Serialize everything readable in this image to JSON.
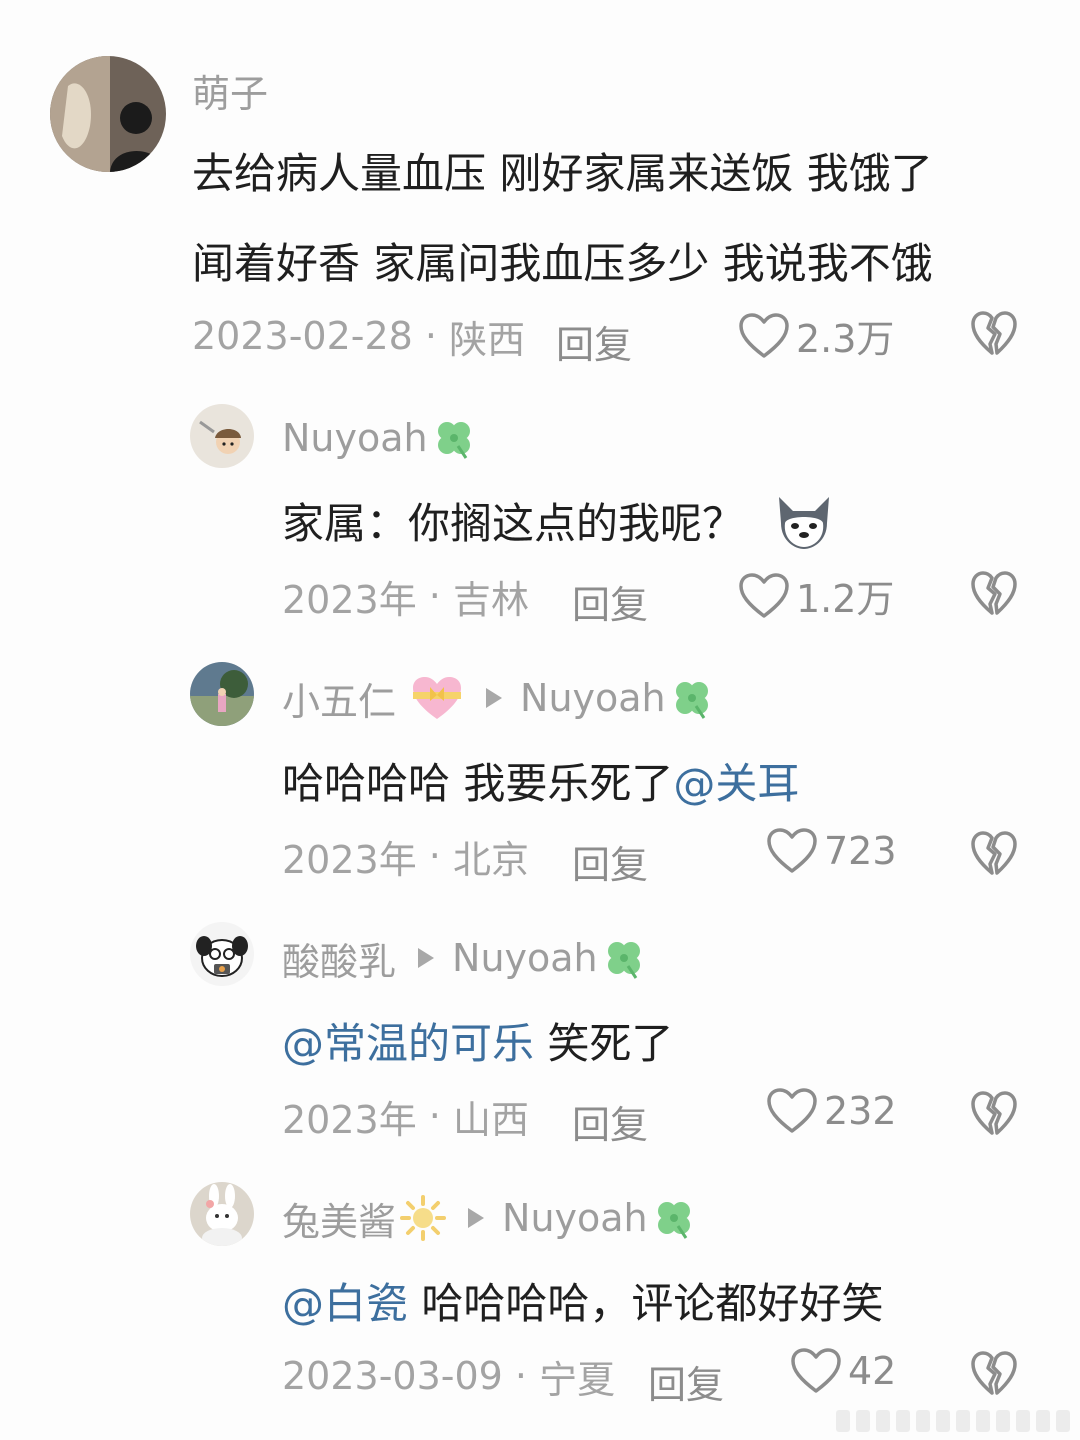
{
  "comments": [
    {
      "author": "萌子",
      "reply_to": "",
      "lines": [
        "去给病人量血压 刚好家属来送饭 我饿了",
        "闻着好香 家属问我血压多少 我说我不饿"
      ],
      "date": "2023-02-28",
      "location": "陕西",
      "reply_label": "回复",
      "likes": "2.3万"
    },
    {
      "author": "Nuyoah",
      "reply_to": "",
      "text": "家属：你搁这点的我呢？",
      "date": "2023年",
      "location": "吉林",
      "reply_label": "回复",
      "likes": "1.2万"
    },
    {
      "author": "小五仁",
      "reply_to": "Nuyoah",
      "text": "哈哈哈哈 我要乐死了",
      "mention": "@关耳",
      "date": "2023年",
      "location": "北京",
      "reply_label": "回复",
      "likes": "723"
    },
    {
      "author": "酸酸乳",
      "reply_to": "Nuyoah",
      "mention": "@常温的可乐",
      "text": " 笑死了",
      "date": "2023年",
      "location": "山西",
      "reply_label": "回复",
      "likes": "232"
    },
    {
      "author": "兔美酱",
      "reply_to": "Nuyoah",
      "mention": "@白瓷",
      "text": " 哈哈哈哈，评论都好好笑",
      "date": "2023-03-09",
      "location": "宁夏",
      "reply_label": "回复",
      "likes": "42"
    }
  ],
  "separator": " · ",
  "icons": {
    "like": "heart-outline-icon",
    "dislike": "broken-heart-icon",
    "clover": "four-leaf-clover-emoji",
    "heart_ribbon": "heart-with-ribbon-emoji",
    "sun": "sun-emoji",
    "dog": "doge-emoji"
  },
  "colors": {
    "mention": "#3d6f9e",
    "meta": "#a3a3a3",
    "name": "#9d9d9d"
  }
}
